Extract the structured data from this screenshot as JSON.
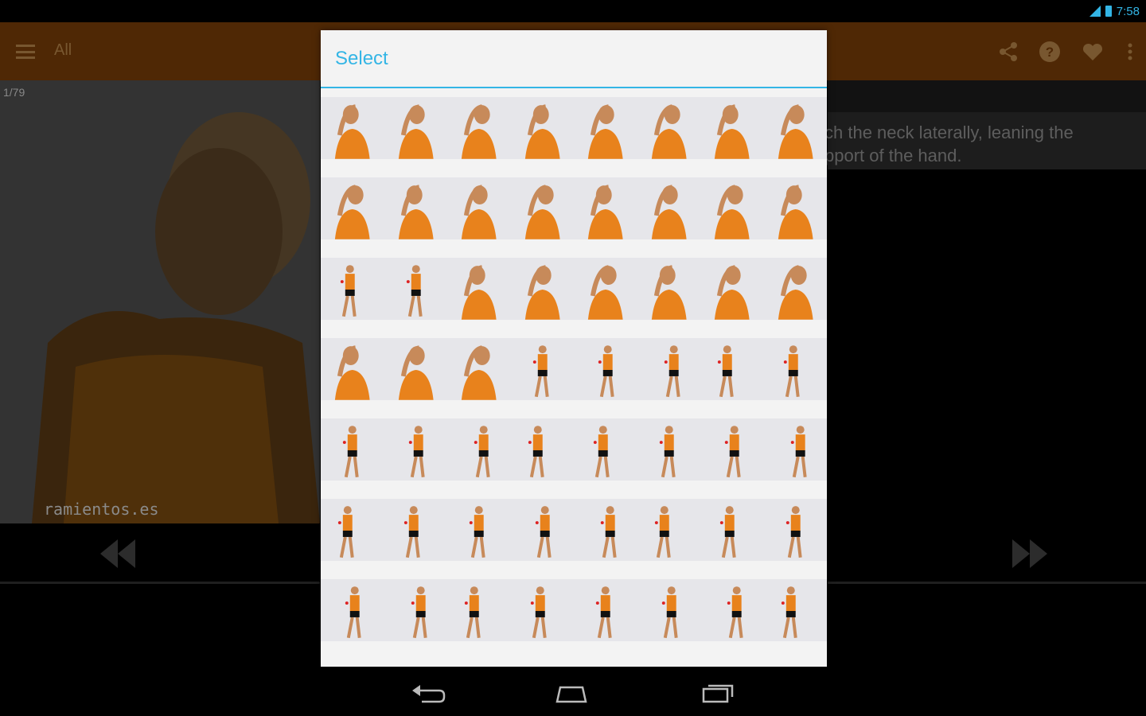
{
  "status_bar": {
    "time": "7:58",
    "signal_icon": "signal-icon",
    "battery_icon": "battery-icon"
  },
  "action_bar": {
    "menu_icon": "menu-icon",
    "title": "All",
    "actions": [
      "share-icon",
      "help-icon",
      "favorite-icon",
      "overflow-menu-icon"
    ],
    "background": "#7a3e08"
  },
  "main": {
    "counter": "1/79",
    "watermark": "ramientos.es",
    "description": "ch the neck laterally, leaning the\npport of the hand.",
    "prev_icon": "rewind-icon",
    "next_icon": "fast-forward-icon"
  },
  "dialog": {
    "title": "Select",
    "accent": "#33b5e5",
    "rows": 7,
    "columns": 8,
    "thumbnail_icon": "exercise-figure-icon"
  },
  "nav_bar": {
    "back_icon": "back-icon",
    "home_icon": "home-icon",
    "recent_icon": "recent-apps-icon"
  }
}
